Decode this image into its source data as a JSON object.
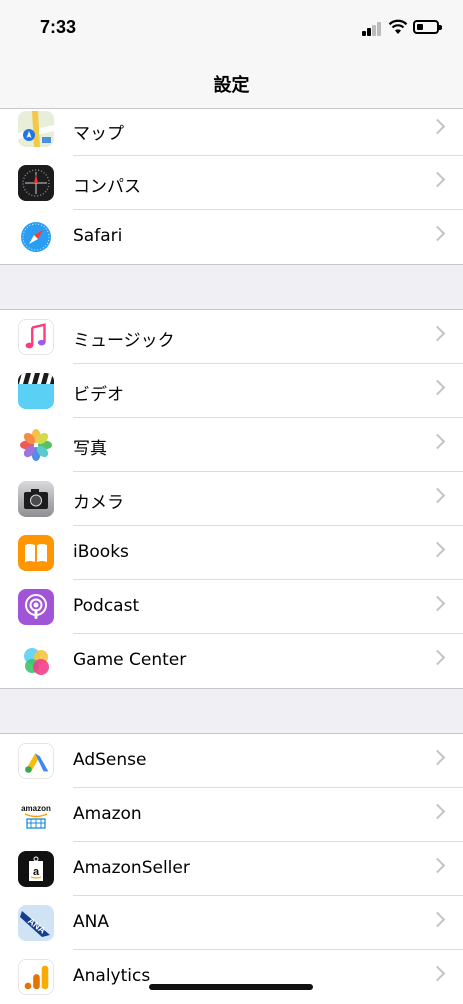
{
  "status_bar": {
    "time": "7:33",
    "icons": [
      "signal-icon",
      "wifi-icon",
      "battery-icon"
    ]
  },
  "nav": {
    "title": "設定"
  },
  "groups": [
    {
      "items": [
        {
          "label": "マップ",
          "icon": "maps-icon"
        },
        {
          "label": "コンパス",
          "icon": "compass-icon"
        },
        {
          "label": "Safari",
          "icon": "safari-icon"
        }
      ]
    },
    {
      "items": [
        {
          "label": "ミュージック",
          "icon": "music-icon"
        },
        {
          "label": "ビデオ",
          "icon": "video-icon"
        },
        {
          "label": "写真",
          "icon": "photos-icon"
        },
        {
          "label": "カメラ",
          "icon": "camera-icon"
        },
        {
          "label": "iBooks",
          "icon": "ibooks-icon"
        },
        {
          "label": "Podcast",
          "icon": "podcast-icon"
        },
        {
          "label": "Game Center",
          "icon": "game-center-icon"
        }
      ]
    },
    {
      "items": [
        {
          "label": "AdSense",
          "icon": "adsense-icon"
        },
        {
          "label": "Amazon",
          "icon": "amazon-icon"
        },
        {
          "label": "AmazonSeller",
          "icon": "amazon-seller-icon"
        },
        {
          "label": "ANA",
          "icon": "ana-icon"
        },
        {
          "label": "Analytics",
          "icon": "analytics-icon"
        }
      ]
    }
  ],
  "icon_text": {
    "amazon": "amazon",
    "ana": "ANA"
  }
}
